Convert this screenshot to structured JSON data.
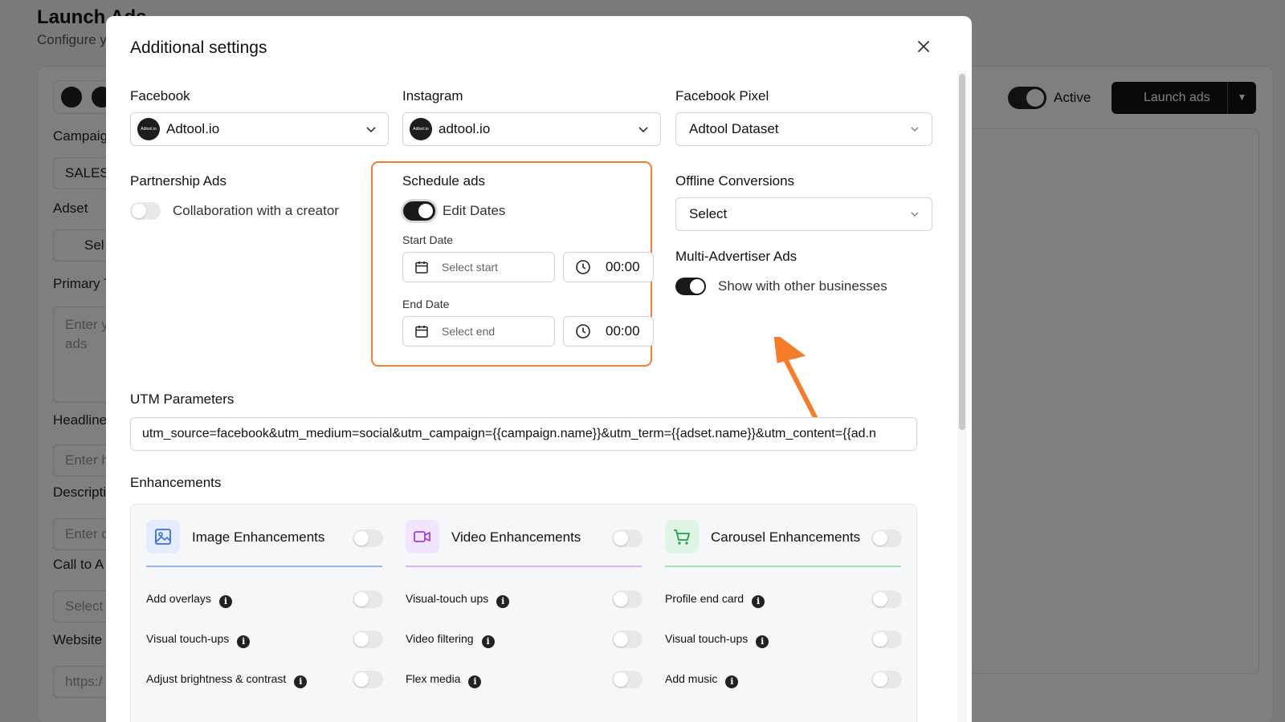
{
  "background": {
    "title": "Launch Ads",
    "subtitle": "Configure y",
    "active_label": "Active",
    "launch_label": "Launch ads",
    "campaign_label": "Campaig",
    "campaign_value": "SALES",
    "adset_label": "Adset",
    "adset_value": "Sel",
    "primary_label": "Primary T",
    "primary_placeholder": "Enter y ads",
    "headline_label": "Headline",
    "headline_placeholder": "Enter h",
    "description_label": "Descripti",
    "description_placeholder": "Enter d",
    "cta_label": "Call to A",
    "cta_placeholder": "Select",
    "website_label": "Website",
    "website_placeholder": "https:/"
  },
  "modal": {
    "title": "Additional settings",
    "facebook": {
      "label": "Facebook",
      "value": "Adtool.io",
      "avatar_text": "Adtool.io"
    },
    "instagram": {
      "label": "Instagram",
      "value": "adtool.io",
      "avatar_text": "Adtool.io"
    },
    "pixel": {
      "label": "Facebook Pixel",
      "value": "Adtool Dataset"
    },
    "partnership": {
      "label": "Partnership Ads",
      "toggle_label": "Collaboration with a creator"
    },
    "schedule": {
      "label": "Schedule ads",
      "toggle_label": "Edit Dates",
      "start_label": "Start Date",
      "start_placeholder": "Select start",
      "start_time": "00:00",
      "end_label": "End Date",
      "end_placeholder": "Select end",
      "end_time": "00:00"
    },
    "offline": {
      "label": "Offline Conversions",
      "value": "Select"
    },
    "multi_advertiser": {
      "label": "Multi-Advertiser Ads",
      "toggle_label": "Show with other businesses"
    },
    "utm": {
      "label": "UTM Parameters",
      "value": "utm_source=facebook&utm_medium=social&utm_campaign={{campaign.name}}&utm_term={{adset.name}}&utm_content={{ad.n"
    },
    "enhancements": {
      "label": "Enhancements",
      "columns": [
        {
          "title": "Image Enhancements",
          "icon": "image-icon",
          "accent": "#93b4f5",
          "items": [
            "Add overlays",
            "Visual touch-ups",
            "Adjust brightness & contrast"
          ]
        },
        {
          "title": "Video Enhancements",
          "icon": "video-icon",
          "accent": "#d6b4f5",
          "items": [
            "Visual-touch ups",
            "Video filtering",
            "Flex media"
          ]
        },
        {
          "title": "Carousel Enhancements",
          "icon": "cart-icon",
          "accent": "#9fe3b3",
          "items": [
            "Profile end card",
            "Visual touch-ups",
            "Add music"
          ]
        }
      ]
    }
  },
  "colors": {
    "highlight": "#f57c2b",
    "toggle_on": "#1a1a1a",
    "toggle_off": "#e8e8ea"
  }
}
